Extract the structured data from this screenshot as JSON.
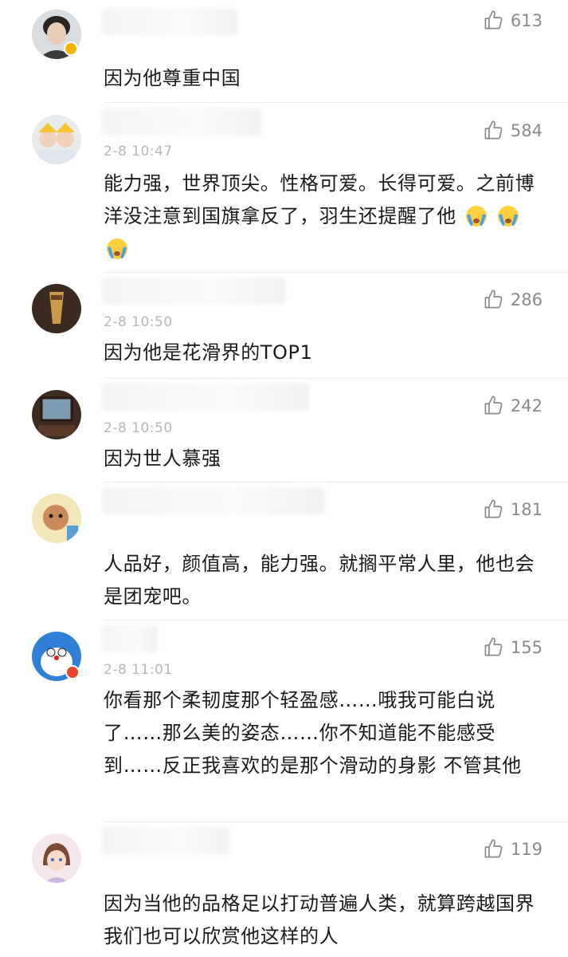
{
  "comments": [
    {
      "timestamp": "",
      "likes": "613",
      "text": "因为他尊重中国"
    },
    {
      "timestamp": "2-8 10:47",
      "likes": "584",
      "text": "能力强，世界顶尖。性格可爱。长得可爱。之前博洋没注意到国旗拿反了，羽生还提醒了他"
    },
    {
      "timestamp": "2-8 10:50",
      "likes": "286",
      "text": "因为他是花滑界的TOP1"
    },
    {
      "timestamp": "2-8 10:50",
      "likes": "242",
      "text": "因为世人慕强"
    },
    {
      "timestamp": "",
      "likes": "181",
      "text": "人品好，颜值高，能力强。就搁平常人里，他也会是团宠吧。"
    },
    {
      "timestamp": "2-8 11:01",
      "likes": "155",
      "text": "你看那个柔韧度那个轻盈感……哦我可能白说了……那么美的姿态……你不知道能不能感受到……反正我喜欢的是那个滑动的身影 不管其他"
    },
    {
      "timestamp": "",
      "likes": "119",
      "text": "因为当他的品格足以打动普遍人类，就算跨越国界我们也可以欣赏他这样的人"
    }
  ]
}
